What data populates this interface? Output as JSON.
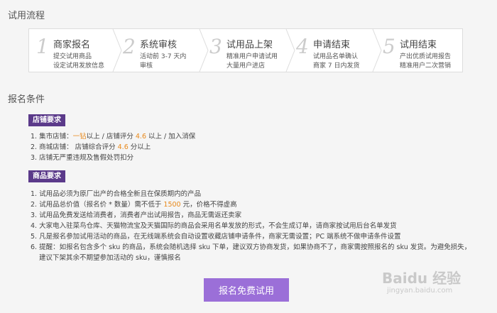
{
  "process_title": "试用流程",
  "steps": [
    {
      "num": "1",
      "title": "商家报名",
      "line1": "提交试用商品",
      "line2": "设定试用发放信息"
    },
    {
      "num": "2",
      "title": "系统审核",
      "line1": "活动前 3-7 天内",
      "line2": "审核"
    },
    {
      "num": "3",
      "title": "试用品上架",
      "line1": "精准用户申请试用",
      "line2": "大量用户进店"
    },
    {
      "num": "4",
      "title": "申请结束",
      "line1": "试用品名单确认",
      "line2": "商家 7 日内发货"
    },
    {
      "num": "5",
      "title": "试用结束",
      "line1": "产出优质试用报告",
      "line2": "精准用户二次营销"
    }
  ],
  "conditions_title": "报名条件",
  "shop_badge": "店铺要求",
  "shop_items": [
    {
      "pre": "1. 集市店铺：",
      "hl": "一钻",
      "post": "以上 / 店铺评分 ",
      "hl2": "4.6",
      "post2": " 以上 / 加入消保"
    },
    {
      "pre": "2. 商城店铺：  店铺综合评分 ",
      "hl": "4.6",
      "post": " 分以上",
      "hl2": "",
      "post2": ""
    },
    {
      "pre": "3. 店铺无严重违规及售假处罚扣分",
      "hl": "",
      "post": "",
      "hl2": "",
      "post2": ""
    }
  ],
  "goods_badge": "商品要求",
  "goods_items": [
    {
      "pre": "1. 试用品必须为原厂出产的合格全新且在保质期内的产品",
      "hl": "",
      "post": ""
    },
    {
      "pre": "2. 试用品总价值（报名价 * 数量）需不低于 ",
      "hl": "1500",
      "post": " 元，价格不得虚高"
    },
    {
      "pre": "3. 试用品免费发送给消费者，消费者产出试用报告，商品无需返还卖家",
      "hl": "",
      "post": ""
    },
    {
      "pre": "4. 大家电入驻菜鸟仓库、天猫物流宝及天猫国际的商品会采用名单发放的形式，不会生成订单，请商家按试用后台名单发货",
      "hl": "",
      "post": ""
    },
    {
      "pre": "5. 凡是报名参加试用活动的商品，在无线端系统会自动设置收藏店铺申请条件，商家无需设置；PC 端系统不做申请条件设置",
      "hl": "",
      "post": ""
    },
    {
      "pre": "6. 提醒：如报名包含多个 sku 的商品，系统会随机选择 sku 下单，建议双方协商发货，如果协商不了，商家需按照报名的 sku 发货。为避免损失，",
      "hl": "",
      "post": ""
    }
  ],
  "goods_continuation": "建议下架其余不期望参加活动的 sku，谨慎报名",
  "apply_button": "报名免费试用",
  "watermark": "Baidu 经验",
  "watermark_url": "jingyan.baidu.com"
}
